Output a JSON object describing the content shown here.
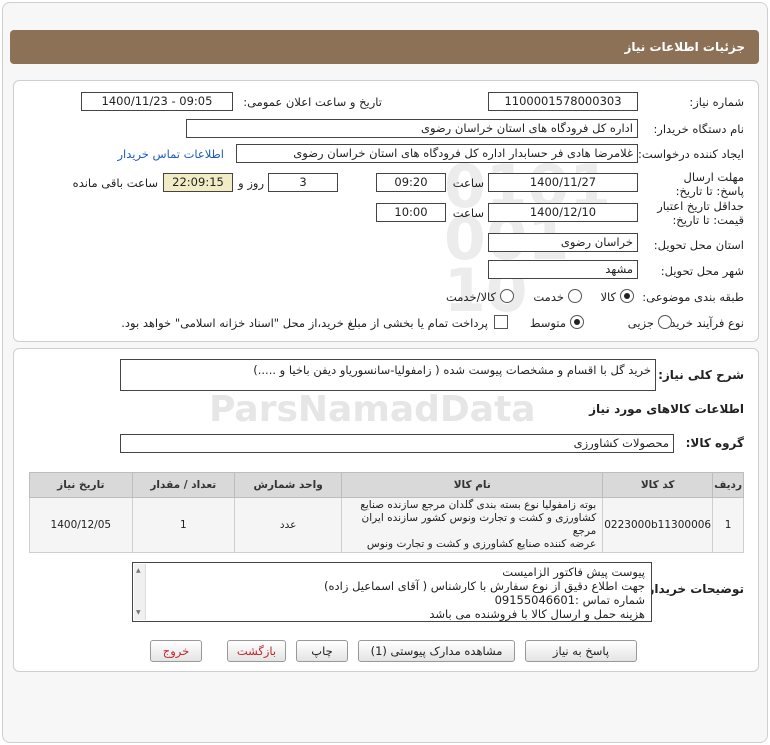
{
  "header": {
    "title": "جزئیات اطلاعات نیاز"
  },
  "form": {
    "need_number_label": "شماره نیاز:",
    "need_number": "1100001578000303",
    "announce_label": "تاریخ و ساعت اعلان عمومی:",
    "announce_value": "1400/11/23 - 09:05",
    "buyer_org_label": "نام دستگاه خریدار:",
    "buyer_org": "اداره کل فرودگاه های استان خراسان رضوی",
    "creator_label": "ایجاد کننده درخواست:",
    "creator": "غلامرضا هادی فر حسابدار اداره کل فرودگاه های استان خراسان رضوی",
    "contact_link": "اطلاعات تماس خریدار",
    "reply_deadline_label": "مهلت ارسال پاسخ: تا تاریخ:",
    "reply_date": "1400/11/27",
    "time_label": "ساعت",
    "reply_time": "09:20",
    "days_value": "3",
    "days_label": "روز و",
    "remaining_time": "22:09:15",
    "remaining_label": "ساعت باقی مانده",
    "validity_label": "حداقل تاریخ اعتبار قیمت: تا تاریخ:",
    "validity_date": "1400/12/10",
    "validity_time_label": "ساعت",
    "validity_time": "10:00",
    "province_label": "استان محل تحویل:",
    "province": "خراسان رضوی",
    "city_label": "شهر محل تحویل:",
    "city": "مشهد",
    "category_label": "طبقه بندی موضوعی:",
    "category_options": [
      "کالا",
      "خدمت",
      "کالا/خدمت"
    ],
    "process_label": "نوع فرآیند خرید :",
    "process_options": [
      "جزیی",
      "متوسط"
    ],
    "payment_note": "پرداخت تمام یا بخشی از مبلغ خرید،از محل \"اسناد خزانه اسلامی\" خواهد بود."
  },
  "summary": {
    "label": "شرح کلی نیاز:",
    "text": "خرید گل با اقسام و مشخصات پیوست شده ( زامفولیا-سانسوریاو دیفن باخیا و .....)",
    "items_title": "اطلاعات کالاهای مورد نیاز",
    "group_label": "گروه کالا:",
    "group_value": "محصولات کشاورزی"
  },
  "table": {
    "headers": [
      "ردیف",
      "کد کالا",
      "نام کالا",
      "واحد شمارش",
      "تعداد / مقدار",
      "تاریخ نیاز"
    ],
    "rows": [
      {
        "row": "1",
        "code": "0223000b11300006",
        "name_lines": [
          "بوته زامفولیا نوع بسته بندی گلدان مرجع سازنده صنایع",
          "کشاورزی و کشت و تجارت ونوس کشور سازنده ایران مرجع",
          "عرضه کننده صنایع کشاورزی و کشت و تجارت ونوس"
        ],
        "unit": "عدد",
        "qty": "1",
        "date": "1400/12/05"
      }
    ]
  },
  "notes": {
    "label": "توضیحات خریدار:",
    "lines": [
      "پیوست پیش فاکتور الزامیست",
      "جهت اطلاع دقیق از نوع سفارش با کارشناس  ( آقای اسماعیل زاده)",
      "شماره تماس :09155046601",
      "هزینه حمل و ارسال کالا با فروشنده می باشد"
    ]
  },
  "buttons": {
    "reply": "پاسخ به نیاز",
    "attachments": "مشاهده مدارک پیوستی (1)",
    "print": "چاپ",
    "back": "بازگشت",
    "exit": "خروج"
  }
}
